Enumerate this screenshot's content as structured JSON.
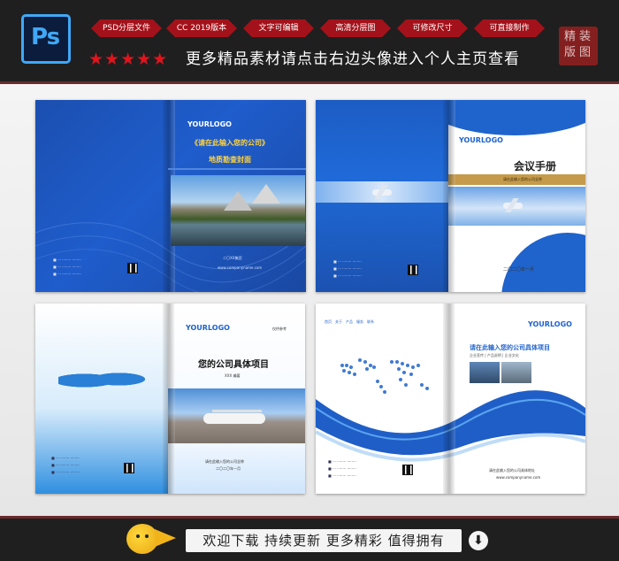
{
  "header": {
    "ps_logo": "Ps",
    "tags": [
      "PSD分层文件",
      "CC 2019版本",
      "文字可编辑",
      "高清分层图",
      "可修改尺寸",
      "可直接制作"
    ],
    "stars": "★★★★★",
    "promo": "更多精品素材请点击右边头像进入个人主页查看",
    "seal_chars": [
      "精",
      "装",
      "版",
      "图"
    ]
  },
  "mockups": {
    "m1": {
      "logo": "YOURLOGO",
      "title_line1": "《请在此输入您的公司》",
      "title_line2": "地质勘查封面",
      "company": "二〇XX集团",
      "website": "www.companyname.com"
    },
    "m2": {
      "headline": "会议手册",
      "logo": "YOURLOGO",
      "band_text": "请在此输入您的公司全称",
      "date": "二〇二〇年一月"
    },
    "m3": {
      "logo": "YOURLOGO",
      "corner_tag": "仅供参考",
      "title": "您的公司具体项目",
      "author": "XXX 编著",
      "company_line": "请在此输入您的公司全称",
      "date": "二〇二〇年一月"
    },
    "m4": {
      "logo": "YOURLOGO",
      "nav_items": [
        "首页",
        "关于",
        "产品",
        "服务",
        "联系"
      ],
      "title": "请在此输入您的公司具体项目",
      "subtitle": "企业宣传 | 产品说明 | 企业文化",
      "address": "请在此输入您的公司具体地址",
      "website": "www.companyname.com"
    }
  },
  "footer": {
    "slogan": "欢迎下载 持续更新 更多精彩 值得拥有",
    "download_arrow": "⬇"
  }
}
